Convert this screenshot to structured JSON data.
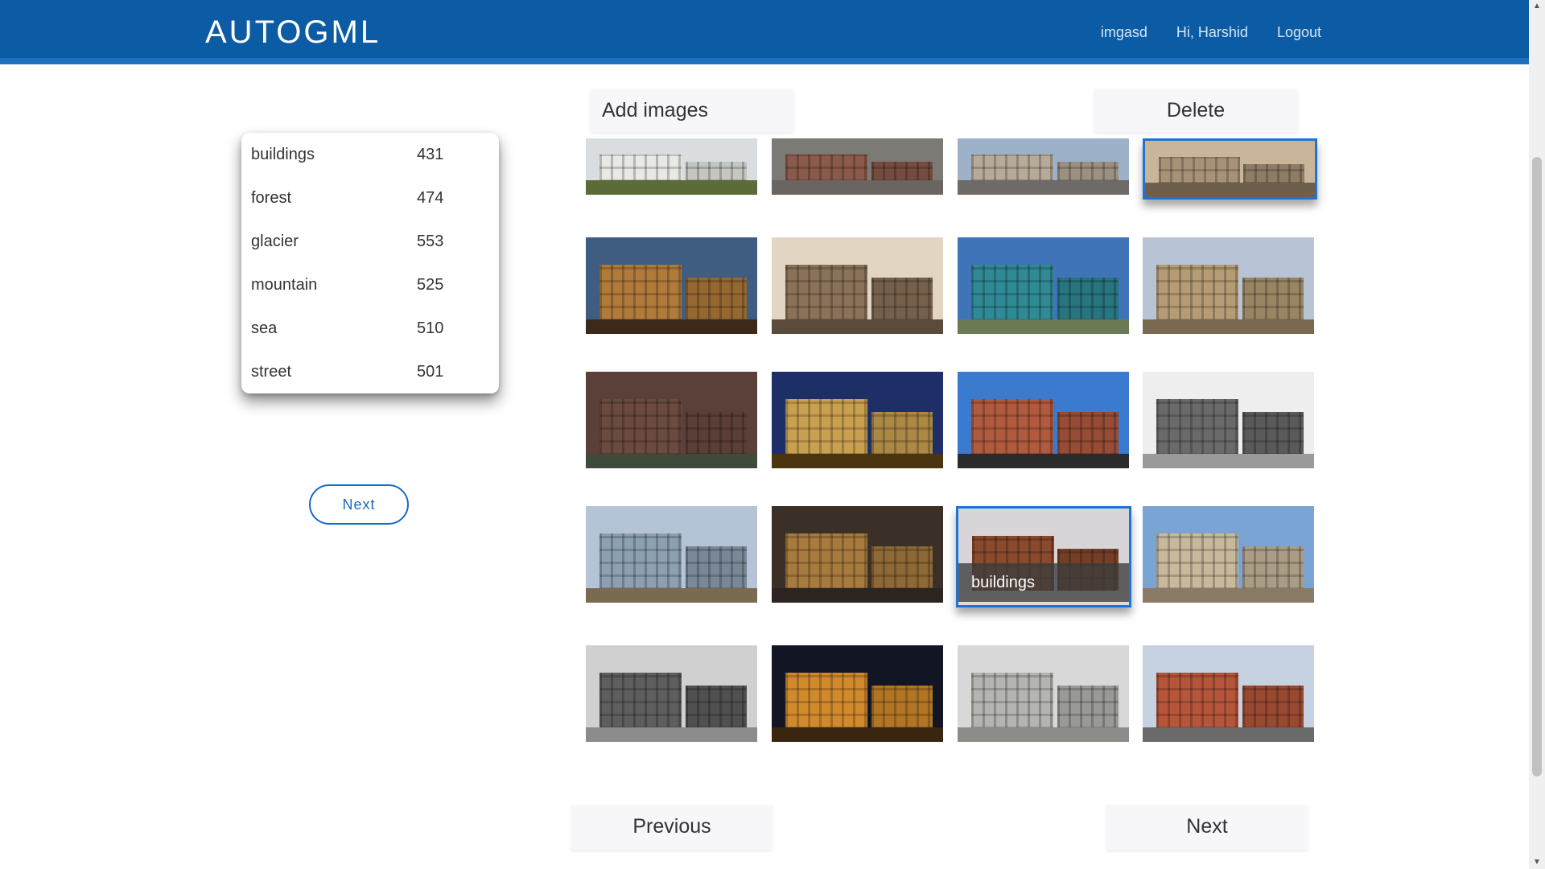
{
  "header": {
    "brand": "AUTOGML",
    "nav": [
      "imgasd",
      "Hi, Harshid",
      "Logout"
    ]
  },
  "classes": [
    {
      "label": "buildings",
      "count": "431"
    },
    {
      "label": "forest",
      "count": "474"
    },
    {
      "label": "glacier",
      "count": "553"
    },
    {
      "label": "mountain",
      "count": "525"
    },
    {
      "label": "sea",
      "count": "510"
    },
    {
      "label": "street",
      "count": "501"
    }
  ],
  "sidebar_next": "Next",
  "actions": {
    "add_images": "Add images",
    "delete": "Delete",
    "previous": "Previous",
    "next": "Next"
  },
  "gallery": {
    "hover_caption": "buildings",
    "images": [
      {
        "name": "modern-building-white",
        "sky": "#d9dde0",
        "bld": "#e8e8e4",
        "ground": "#5b6b3a",
        "selected": false
      },
      {
        "name": "street-plaza",
        "sky": "#7c7a74",
        "bld": "#8a5a4a",
        "ground": "#6a6560",
        "selected": false
      },
      {
        "name": "glass-tower-arch",
        "sky": "#9db2c8",
        "bld": "#b7aa98",
        "ground": "#6d6a68",
        "selected": false
      },
      {
        "name": "classic-facade-windows",
        "sky": "#c9b59a",
        "bld": "#a89277",
        "ground": "#6e5e4e",
        "selected": true
      },
      {
        "name": "city-skyline-dusk",
        "sky": "#3f5d80",
        "bld": "#b07a3a",
        "ground": "#3b2a1a",
        "selected": false
      },
      {
        "name": "stone-church",
        "sky": "#e2d6c2",
        "bld": "#8a7258",
        "ground": "#5a4b3a",
        "selected": false
      },
      {
        "name": "teal-house",
        "sky": "#3f74b8",
        "bld": "#2f8a96",
        "ground": "#6b7a55",
        "selected": false
      },
      {
        "name": "palace-facade",
        "sky": "#b8c4d6",
        "bld": "#b59c74",
        "ground": "#7a6a52",
        "selected": false
      },
      {
        "name": "apartment-block",
        "sky": "#5a4038",
        "bld": "#6b4a40",
        "ground": "#3f4a3a",
        "selected": false
      },
      {
        "name": "waterfront-night",
        "sky": "#1e2e66",
        "bld": "#c9a050",
        "ground": "#4a3510",
        "selected": false
      },
      {
        "name": "brick-office",
        "sky": "#3a7bd0",
        "bld": "#b05a3e",
        "ground": "#2b2b2b",
        "selected": false
      },
      {
        "name": "construction-bw",
        "sky": "#eeeeee",
        "bld": "#6a6a6a",
        "ground": "#9a9a9a",
        "selected": false
      },
      {
        "name": "tower-cranes",
        "sky": "#b5c3d6",
        "bld": "#8da0b2",
        "ground": "#7b6a52",
        "selected": false
      },
      {
        "name": "golden-tower",
        "sky": "#3a3028",
        "bld": "#a77a3e",
        "ground": "#2b2420",
        "selected": false
      },
      {
        "name": "snowy-house",
        "sky": "#d8d5d8",
        "bld": "#8a4a2e",
        "ground": "#dcdcdc",
        "selected": true
      },
      {
        "name": "skyscrapers",
        "sky": "#7aa4d4",
        "bld": "#c8b89c",
        "ground": "#8a7a66",
        "selected": false
      },
      {
        "name": "wooden-house-bw",
        "sky": "#d0d0d0",
        "bld": "#5e5e5e",
        "ground": "#8c8c8c",
        "selected": false
      },
      {
        "name": "opera-night",
        "sky": "#121524",
        "bld": "#d08a2c",
        "ground": "#3a2510",
        "selected": false
      },
      {
        "name": "columns-entrance",
        "sky": "#d8d8d8",
        "bld": "#b4b4b0",
        "ground": "#8c8c88",
        "selected": false
      },
      {
        "name": "brick-apartments",
        "sky": "#c6d2e2",
        "bld": "#b5563a",
        "ground": "#6a6a6a",
        "selected": false
      }
    ]
  }
}
